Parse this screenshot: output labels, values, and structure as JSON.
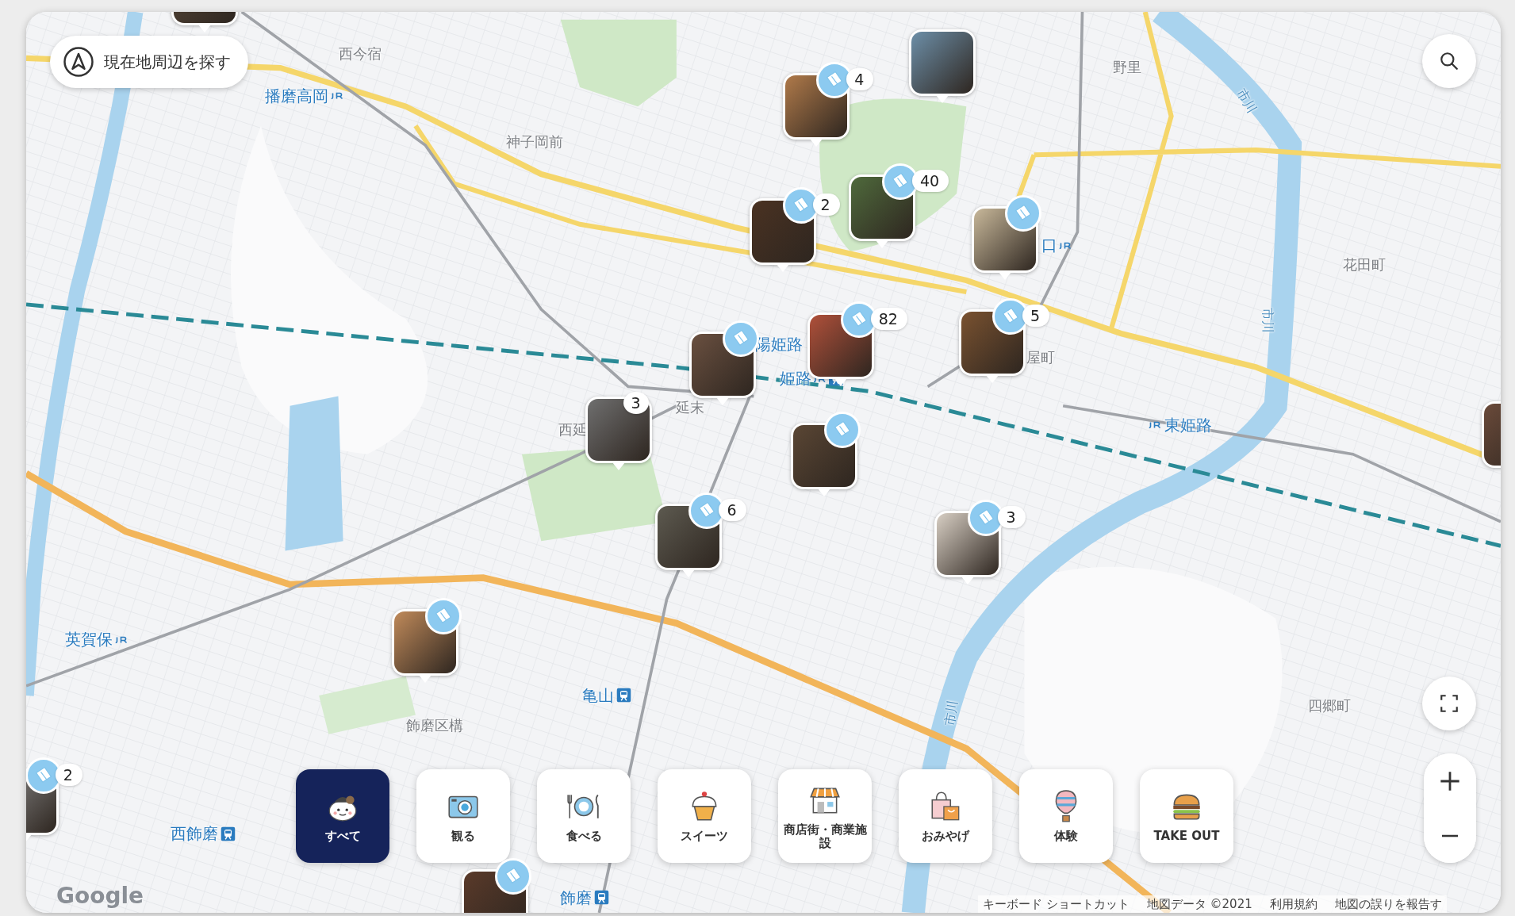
{
  "locate_button": {
    "label": "現在地周辺を探す"
  },
  "place_labels": [
    {
      "text": "西今宿",
      "kind": "area"
    },
    {
      "text": "播磨高岡",
      "kind": "jr"
    },
    {
      "text": "神子岡前",
      "kind": "area"
    },
    {
      "text": "野里",
      "kind": "area"
    },
    {
      "text": "市川",
      "kind": "river"
    },
    {
      "text": "花田町",
      "kind": "area"
    },
    {
      "text": "市川",
      "kind": "river"
    },
    {
      "text": "口",
      "kind": "jr"
    },
    {
      "text": "陽姫路",
      "kind": "station"
    },
    {
      "text": "屋町",
      "kind": "area"
    },
    {
      "text": "姫路",
      "kind": "jr_train"
    },
    {
      "text": "延末",
      "kind": "area"
    },
    {
      "text": "西延",
      "kind": "area"
    },
    {
      "text": "東姫路",
      "kind": "jr_before"
    },
    {
      "text": "英賀保",
      "kind": "jr"
    },
    {
      "text": "亀山",
      "kind": "train"
    },
    {
      "text": "飾磨区構",
      "kind": "area"
    },
    {
      "text": "四郷町",
      "kind": "area"
    },
    {
      "text": "市川",
      "kind": "river"
    },
    {
      "text": "西飾磨",
      "kind": "train"
    },
    {
      "text": "飾磨",
      "kind": "train"
    }
  ],
  "pins": [
    {
      "badge": false
    },
    {
      "badge": true,
      "count": "4"
    },
    {
      "badge": false
    },
    {
      "badge": true,
      "count": "2"
    },
    {
      "badge": true,
      "count": "40"
    },
    {
      "badge": true
    },
    {
      "badge": true,
      "count": "82"
    },
    {
      "badge": true
    },
    {
      "badge": true,
      "count": "5"
    },
    {
      "badge": false,
      "count": "3"
    },
    {
      "badge": true
    },
    {
      "badge": true,
      "count": "6"
    },
    {
      "badge": true,
      "count": "3"
    },
    {
      "badge": true
    },
    {
      "badge": true,
      "count": "2"
    },
    {
      "badge": true
    },
    {
      "badge": false
    }
  ],
  "categories": [
    {
      "label": "すべて",
      "kind": "all",
      "selected": true
    },
    {
      "label": "観る",
      "kind": "see",
      "selected": false
    },
    {
      "label": "食べる",
      "kind": "eat",
      "selected": false
    },
    {
      "label": "スイーツ",
      "kind": "sweets",
      "selected": false
    },
    {
      "label": "商店街・商業施設",
      "kind": "shops",
      "selected": false
    },
    {
      "label": "おみやげ",
      "kind": "souvenir",
      "selected": false
    },
    {
      "label": "体験",
      "kind": "experience",
      "selected": false
    },
    {
      "label": "TAKE OUT",
      "kind": "takeout",
      "selected": false
    }
  ],
  "map_logo": "Google",
  "attribution": [
    "キーボード ショートカット",
    "地図データ ©2021",
    "利用規約",
    "地図の誤りを報告す"
  ]
}
